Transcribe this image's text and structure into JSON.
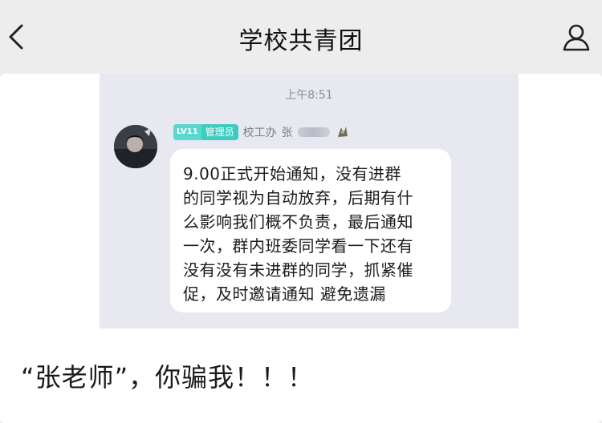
{
  "header": {
    "title": "学校共青团"
  },
  "icons": {
    "back": "chevron-left-icon",
    "user": "user-icon"
  },
  "chat": {
    "time": "上午8:51",
    "sender": {
      "level_badge": "LV11",
      "role_badge": "管理员",
      "department": "校工办",
      "name": "张"
    },
    "message_lines": [
      "9.00正式开始通知，没有进群",
      "的同学视为自动放弃，后期有什",
      "么影响我们概不负责，最后通知",
      "一次，群内班委同学看一下还有",
      "没有没有未进群的同学，抓紧催",
      "促，及时邀请通知 避免遗漏"
    ]
  },
  "caption": "“张老师”，你骗我！！！",
  "colors": {
    "header_bg": "#ededed",
    "chat_bg": "#e7e8f0",
    "badge": "#3ecbc0"
  }
}
